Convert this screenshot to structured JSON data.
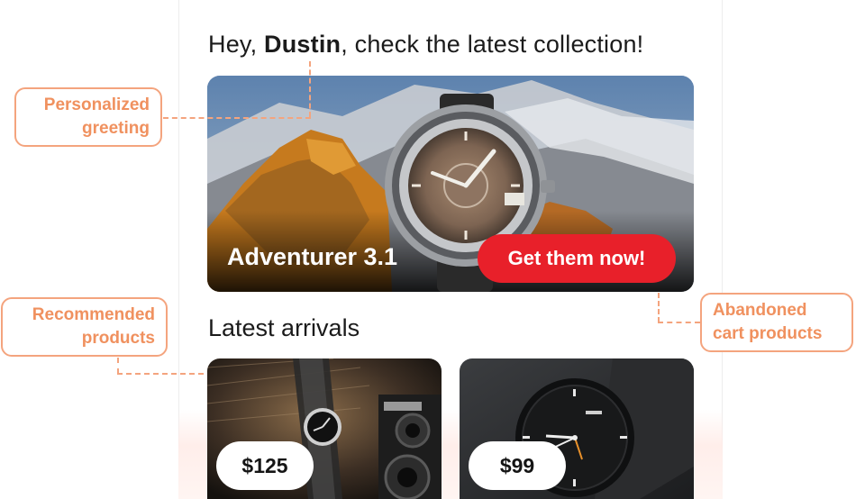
{
  "greeting": {
    "prefix": "Hey, ",
    "name": "Dustin",
    "suffix": ", check the latest collection!"
  },
  "hero": {
    "title": "Adventurer 3.1",
    "cta_label": "Get them now!"
  },
  "latest": {
    "title": "Latest arrivals",
    "products": [
      {
        "price": "$125"
      },
      {
        "price": "$99"
      }
    ]
  },
  "annotations": {
    "personalized": [
      "Personalized",
      "greeting"
    ],
    "recommended": [
      "Recommended",
      "products"
    ],
    "abandoned": [
      "Abandoned",
      "cart products"
    ]
  },
  "colors": {
    "accent_red": "#e8202a",
    "annotation_orange": "#f0915f"
  }
}
